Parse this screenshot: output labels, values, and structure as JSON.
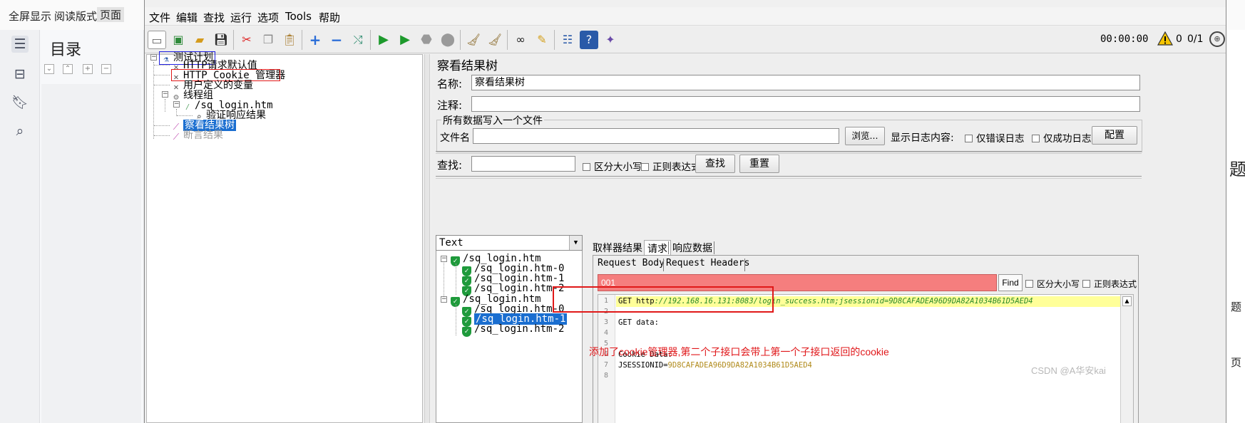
{
  "reader": {
    "tabs": [
      "全屏显示",
      "阅读版式",
      "页面"
    ],
    "toc_title": "目录",
    "right_chars": [
      "题",
      "题",
      "页"
    ]
  },
  "jmeter": {
    "menu": [
      "文件",
      "编辑",
      "查找",
      "运行",
      "选项",
      "Tools",
      "帮助"
    ],
    "status": {
      "timer": "00:00:00",
      "warning_count": "0",
      "threads": "0/1"
    },
    "tree": {
      "root": "测试计划",
      "http_defaults": "HTTP请求默认值",
      "cookie_manager": "HTTP Cookie 管理器",
      "user_vars": "用户定义的变量",
      "thread_group": "线程组",
      "sampler": "/sq_login.htm",
      "assertion": "验证响应结果",
      "view_results": "察看结果树",
      "assert_results": "断言结果"
    },
    "panel": {
      "title": "察看结果树",
      "name_label": "名称:",
      "name_value": "察看结果树",
      "comment_label": "注释:",
      "comment_value": "",
      "fieldset_title": "所有数据写入一个文件",
      "filename_label": "文件名",
      "filename_value": "",
      "browse_btn": "浏览...",
      "log_label": "显示日志内容:",
      "errors_only": "仅错误日志",
      "success_only": "仅成功日志",
      "config_btn": "配置",
      "search_label": "查找:",
      "search_value": "",
      "case_sensitive": "区分大小写",
      "regex": "正则表达式",
      "search_btn": "查找",
      "reset_btn": "重置",
      "renderer": "Text"
    },
    "samples": [
      "/sq_login.htm",
      "/sq_login.htm-0",
      "/sq_login.htm-1",
      "/sq_login.htm-2",
      "/sq_login.htm",
      "/sq_login.htm-0",
      "/sq_login.htm-1",
      "/sq_login.htm-2"
    ],
    "result_tabs": [
      "取样器结果",
      "请求",
      "响应数据"
    ],
    "request_tabs": [
      "Request Body",
      "Request Headers"
    ],
    "find": {
      "value": "001",
      "button": "Find",
      "case_sensitive": "区分大小写",
      "regex": "正则表达式"
    },
    "editor": {
      "line_numbers": [
        "1",
        "2",
        "3",
        "4",
        "5",
        "6",
        "7",
        "8"
      ],
      "line1_method": "GET ",
      "line1_scheme": "http",
      "line1_url": "://192.168.16.131:8083/login_success.htm;jsessionid=9D8CAFADEA96D9DA82A1034B61D5AED4",
      "line3": "GET data:",
      "line6": "Cookie Data:",
      "line7_key": "JSESSIONID=",
      "line7_value": "9D8CAFADEA96D9DA82A1034B61D5AED4"
    }
  },
  "annotation": "添加了cookie管理器,第二个子接口会带上第一个子接口返回的cookie",
  "watermark": "CSDN @A华安kai",
  "colors": {
    "annotation_red": "#e0181b",
    "find_bar": "#f57e7e",
    "selection": "#1a6ed0",
    "highlight_line": "#ffff99"
  }
}
